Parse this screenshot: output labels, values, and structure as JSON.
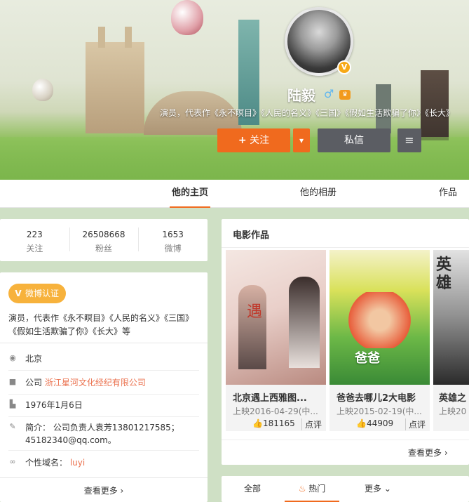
{
  "profile": {
    "name": "陆毅",
    "gender_symbol": "♂",
    "verified_symbol": "V",
    "description": "演员，代表作《永不瞑目》《人民的名义》《三国》《假如生活欺骗了你》《长大》",
    "follow_label": "关注",
    "follow_plus": "+",
    "dropdown_symbol": "▾",
    "message_label": "私信",
    "menu_symbol": "≡"
  },
  "tabs": [
    {
      "label": "他的主页",
      "active": true
    },
    {
      "label": "他的相册",
      "active": false
    },
    {
      "label": "作品",
      "active": false
    }
  ],
  "stats": [
    {
      "value": "223",
      "label": "关注"
    },
    {
      "value": "26508668",
      "label": "粉丝"
    },
    {
      "value": "1653",
      "label": "微博"
    }
  ],
  "info": {
    "verify_badge": "微博认证",
    "verify_v": "V",
    "verify_desc": "演员，代表作《永不瞑目》《人民的名义》《三国》《假如生活欺骗了你》《长大》等",
    "location": "北京",
    "company_prefix": "公司",
    "company": "浙江星河文化经纪有限公司",
    "birthday": "1976年1月6日",
    "intro": "简介： 公司负责人袁芳13801217585；45182340@qq.com。",
    "domain_label": "个性域名：",
    "domain_value": "luyi",
    "more": "查看更多 ›"
  },
  "movies": {
    "title": "电影作品",
    "items": [
      {
        "name": "北京遇上西雅图...",
        "date": "上映2016-04-29(中...",
        "likes": "181165",
        "review": "点评"
      },
      {
        "name": "爸爸去哪儿2大电影",
        "date": "上映2015-02-19(中...",
        "likes": "44909",
        "review": "点评"
      },
      {
        "name": "英雄之",
        "date": "上映20",
        "likes": "",
        "review": ""
      }
    ],
    "more": "查看更多 ›"
  },
  "feed_tabs": [
    {
      "label": "全部"
    },
    {
      "label": "热门"
    },
    {
      "label": "更多 ⌄"
    }
  ],
  "colors": {
    "accent": "#f06a1e",
    "dark_button": "#5b5d63",
    "verify": "#f7b23c",
    "link": "#eb7350"
  }
}
